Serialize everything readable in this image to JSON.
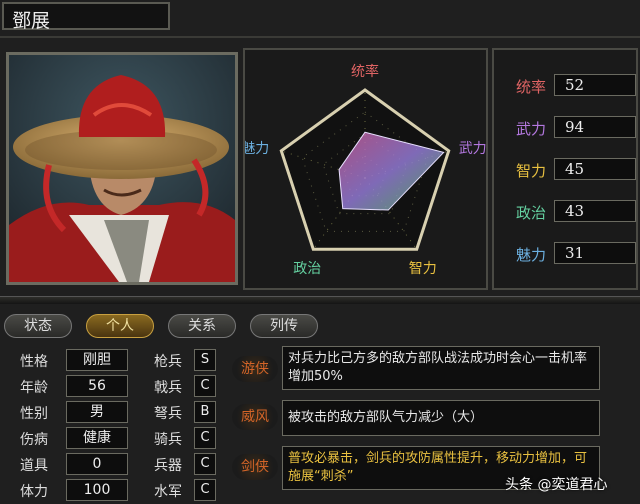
{
  "character": {
    "name": "鄧展"
  },
  "radar": {
    "axes": [
      "统率",
      "武力",
      "智力",
      "政治",
      "魅力"
    ],
    "axis_colors": [
      "#e06464",
      "#b478e0",
      "#e8c040",
      "#64d0a0",
      "#6cb0e0"
    ],
    "values": [
      52,
      94,
      45,
      43,
      31
    ],
    "max": 100
  },
  "stats": [
    {
      "label": "统率",
      "value": "52",
      "color": "#e06464"
    },
    {
      "label": "武力",
      "value": "94",
      "color": "#b478e0"
    },
    {
      "label": "智力",
      "value": "45",
      "color": "#e8c040"
    },
    {
      "label": "政治",
      "value": "43",
      "color": "#64d0a0"
    },
    {
      "label": "魅力",
      "value": "31",
      "color": "#6cb0e0"
    }
  ],
  "tabs": [
    {
      "label": "状态",
      "active": false
    },
    {
      "label": "个人",
      "active": true
    },
    {
      "label": "关系",
      "active": false
    },
    {
      "label": "列传",
      "active": false
    }
  ],
  "attributes": [
    {
      "label": "性格",
      "value": "刚胆"
    },
    {
      "label": "年龄",
      "value": "56"
    },
    {
      "label": "性别",
      "value": "男"
    },
    {
      "label": "伤病",
      "value": "健康"
    },
    {
      "label": "道具",
      "value": "0"
    },
    {
      "label": "体力",
      "value": "100"
    }
  ],
  "troops": [
    {
      "label": "枪兵",
      "grade": "S"
    },
    {
      "label": "戟兵",
      "grade": "C"
    },
    {
      "label": "弩兵",
      "grade": "B"
    },
    {
      "label": "骑兵",
      "grade": "C"
    },
    {
      "label": "兵器",
      "grade": "C"
    },
    {
      "label": "水军",
      "grade": "C"
    }
  ],
  "skills": [
    {
      "name": "游侠",
      "desc": "对兵力比己方多的敌方部队战法成功时会心一击机率增加50%"
    },
    {
      "name": "威风",
      "desc": "被攻击的敌方部队气力减少（大）"
    },
    {
      "name": "剑侠",
      "desc": "普攻必暴击，剑兵的攻防属性提升，移动力增加，可施展“刺杀”"
    }
  ],
  "watermark": "头条 @奕道君心"
}
